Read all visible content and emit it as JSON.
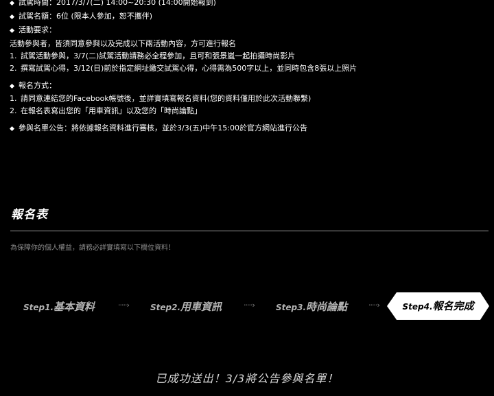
{
  "info": {
    "time": "試駕時間：2017/3/7(二) 14:00~20:30 (14:00開始報到)",
    "quota": "試駕名額：6位 (限本人參加，恕不攜伴)",
    "requirement_title": "活動要求：",
    "requirement_intro": "活動參與者，皆須同意參與以及完成以下兩活動內容，方可進行報名",
    "requirement_items": [
      {
        "num": "1.",
        "text": "試駕活動參與，3/7(二)試駕活動請務必全程參加，且可和張景嵐一起拍攝時尚影片"
      },
      {
        "num": "2.",
        "text": "撰寫試駕心得，3/12(日)前於指定網址繳交試駕心得，心得需為500字以上，並同時包含8張以上照片"
      }
    ],
    "signup_title": "報名方式：",
    "signup_items": [
      {
        "num": "1.",
        "text": "請同意連結您的Facebook帳號後，並詳實填寫報名資料(您的資料僅用於此次活動聯繫)"
      },
      {
        "num": "2.",
        "text": "在報名表寫出您的「用車資訊」以及您的「時尚論點」"
      }
    ],
    "announcement": "參與名單公告：將依據報名資料進行審核，並於3/3(五)中午15:00於官方網站進行公告"
  },
  "form": {
    "title": "報名表",
    "notice": "為保障你的個人權益，請務必詳實填寫以下欄位資料！"
  },
  "steps": [
    {
      "prefix": "Step1.",
      "label": "基本資料"
    },
    {
      "prefix": "Step2.",
      "label": "用車資訊"
    },
    {
      "prefix": "Step3.",
      "label": "時尚論點"
    },
    {
      "prefix": "Step4.",
      "label": "報名完成"
    }
  ],
  "arrow_text": "·····›",
  "success_message": "已成功送出！3/3將公告參與名單！"
}
